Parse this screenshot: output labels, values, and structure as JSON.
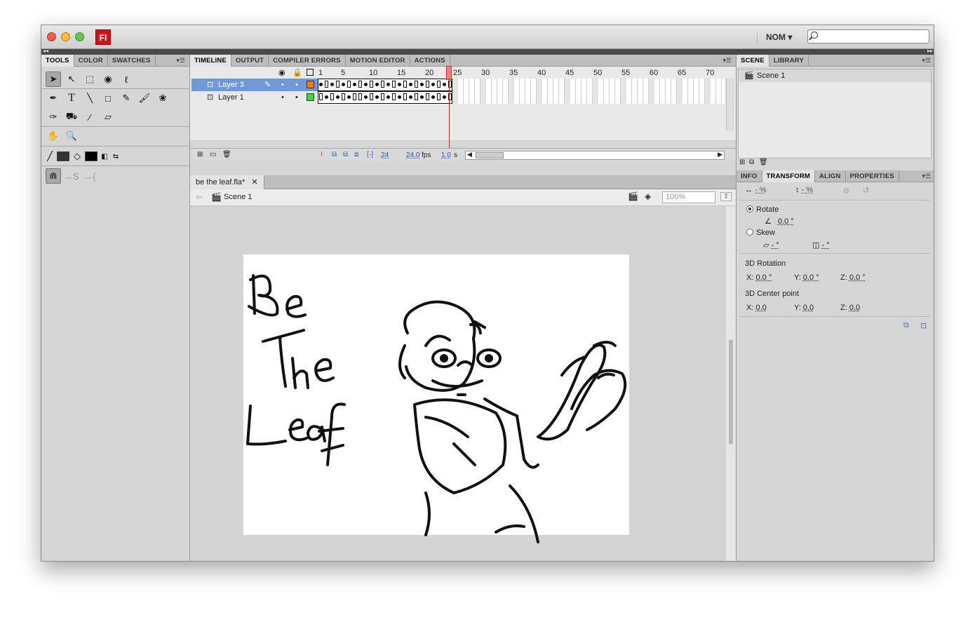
{
  "app": {
    "logo": "Fl",
    "workspace_label": "NOM",
    "search_placeholder": ""
  },
  "left_panel": {
    "tabs": [
      "TOOLS",
      "COLOR",
      "SWATCHES"
    ]
  },
  "timeline": {
    "tabs": [
      "TIMELINE",
      "OUTPUT",
      "COMPILER ERRORS",
      "MOTION EDITOR",
      "ACTIONS"
    ],
    "ruler": [
      "1",
      "5",
      "10",
      "15",
      "20",
      "25",
      "30",
      "35",
      "40",
      "45",
      "50",
      "55",
      "60",
      "65",
      "70"
    ],
    "layers": [
      {
        "name": "Layer 3",
        "color": "#f07c1e",
        "selected": true
      },
      {
        "name": "Layer 1",
        "color": "#38d838",
        "selected": false
      }
    ],
    "current_frame": "24",
    "fps": "24.0",
    "fps_unit": "fps",
    "elapsed": "1.0",
    "elapsed_unit": "s"
  },
  "document": {
    "tab_label": "be the leaf.fla*",
    "scene_label": "Scene 1",
    "zoom": "100%"
  },
  "right_top": {
    "tabs": [
      "SCENE",
      "LIBRARY"
    ],
    "scenes": [
      "Scene 1"
    ]
  },
  "right_bottom": {
    "tabs": [
      "INFO",
      "TRANSFORM",
      "ALIGN",
      "PROPERTIES"
    ],
    "width_pct": "- %",
    "height_pct": "- %",
    "rotate_label": "Rotate",
    "rotate_value": "0.0 °",
    "skew_label": "Skew",
    "skew_h": "- °",
    "skew_v": "- °",
    "rotation3d_label": "3D Rotation",
    "rot_x_label": "X:",
    "rot_x": "0.0 °",
    "rot_y_label": "Y:",
    "rot_y": "0.0 °",
    "rot_z_label": "Z:",
    "rot_z": "0.0 °",
    "center_label": "3D Center point",
    "c_x_label": "X:",
    "c_x": "0.0",
    "c_y_label": "Y:",
    "c_y": "0.0",
    "c_z_label": "Z:",
    "c_z": "0.0"
  },
  "canvas_art": {
    "text_lines": [
      "Be",
      "The",
      "Leaf"
    ]
  }
}
